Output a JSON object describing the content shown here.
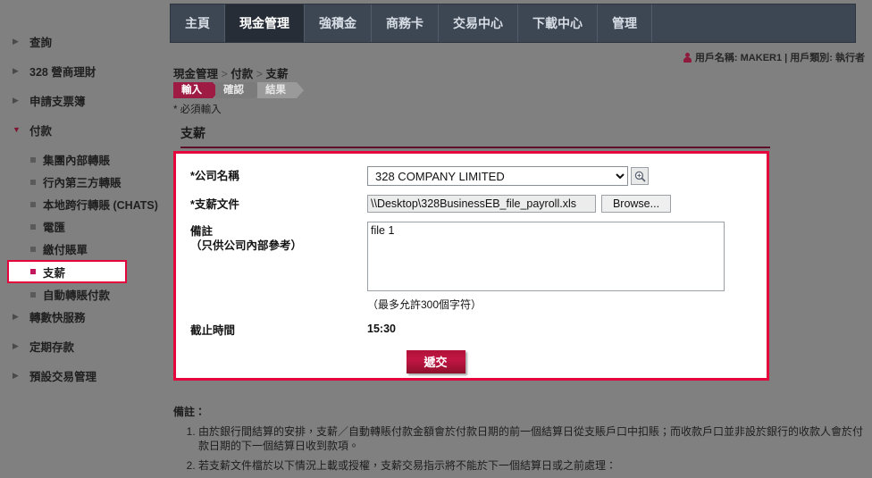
{
  "sidebar": {
    "items": [
      {
        "label": "查詢",
        "type": "top",
        "expanded": false
      },
      {
        "label": "328 營商理財",
        "type": "top",
        "expanded": false
      },
      {
        "label": "申請支票簿",
        "type": "top",
        "expanded": false
      },
      {
        "label": "付款",
        "type": "top",
        "expanded": true
      },
      {
        "label": "集團內部轉賬",
        "type": "sub",
        "selected": false
      },
      {
        "label": "行內第三方轉賬",
        "type": "sub",
        "selected": false
      },
      {
        "label": "本地跨行轉賬 (CHATS)",
        "type": "sub",
        "selected": false
      },
      {
        "label": "電匯",
        "type": "sub",
        "selected": false
      },
      {
        "label": "繳付賬單",
        "type": "sub",
        "selected": false
      },
      {
        "label": "支薪",
        "type": "sub",
        "selected": true
      },
      {
        "label": "自動轉賬付款",
        "type": "sub",
        "selected": false
      },
      {
        "label": "轉數快服務",
        "type": "top",
        "expanded": false
      },
      {
        "label": "定期存款",
        "type": "top",
        "expanded": false
      },
      {
        "label": "預設交易管理",
        "type": "top",
        "expanded": false
      }
    ],
    "expanded_marker": "▼",
    "collapsed_marker": "▶"
  },
  "topnav": {
    "tabs": [
      {
        "label": "主頁",
        "active": false
      },
      {
        "label": "現金管理",
        "active": true
      },
      {
        "label": "強積金",
        "active": false
      },
      {
        "label": "商務卡",
        "active": false
      },
      {
        "label": "交易中心",
        "active": false
      },
      {
        "label": "下載中心",
        "active": false
      },
      {
        "label": "管理",
        "active": false
      }
    ]
  },
  "userinfo": {
    "icon": "person-icon",
    "text": "用戶名稱: MAKER1 | 用戶類別: 執行者"
  },
  "breadcrumb": {
    "part1": "現金管理",
    "sep1": " > ",
    "part2": "付款",
    "sep2": " > ",
    "part3": "支薪"
  },
  "steps": [
    {
      "label": "輸入",
      "state": "active"
    },
    {
      "label": "確認",
      "state": "inactive"
    },
    {
      "label": "結果",
      "state": "inactive"
    }
  ],
  "required_note": "* 必須輸入",
  "section_title": "支薪",
  "form": {
    "company": {
      "label": "*公司名稱",
      "value": "328 COMPANY LIMITED",
      "options": [
        "328 COMPANY LIMITED"
      ],
      "lookup_icon": "magnifier-icon"
    },
    "payroll_file": {
      "label": "*支薪文件",
      "value": "\\\\Desktop\\328BusinessEB_file_payroll.xls",
      "browse_label": "Browse..."
    },
    "remark": {
      "label": "備註",
      "sublabel": "（只供公司內部參考）",
      "value": "file 1",
      "placeholder": "",
      "hint": "（最多允許300個字符）"
    },
    "cutoff": {
      "label": "截止時間",
      "value": "15:30"
    },
    "submit_label": "遞交"
  },
  "notes": {
    "title": "備註：",
    "items": [
      "由於銀行間結算的安排，支薪／自動轉賬付款金額會於付款日期的前一個結算日從支賬戶口中扣賬；而收款戶口並非設於銀行的收款人會於付款日期的下一個結算日收到款項。",
      "若支薪文件檔於以下情況上載或授權，支薪交易指示將不能於下一個結算日或之前處理："
    ]
  },
  "colors": {
    "accent_red": "#e4053c",
    "dark_red": "#9e1b43",
    "nav_bar": "#3d4653",
    "nav_active": "#262d36",
    "page_bg": "#808080"
  }
}
